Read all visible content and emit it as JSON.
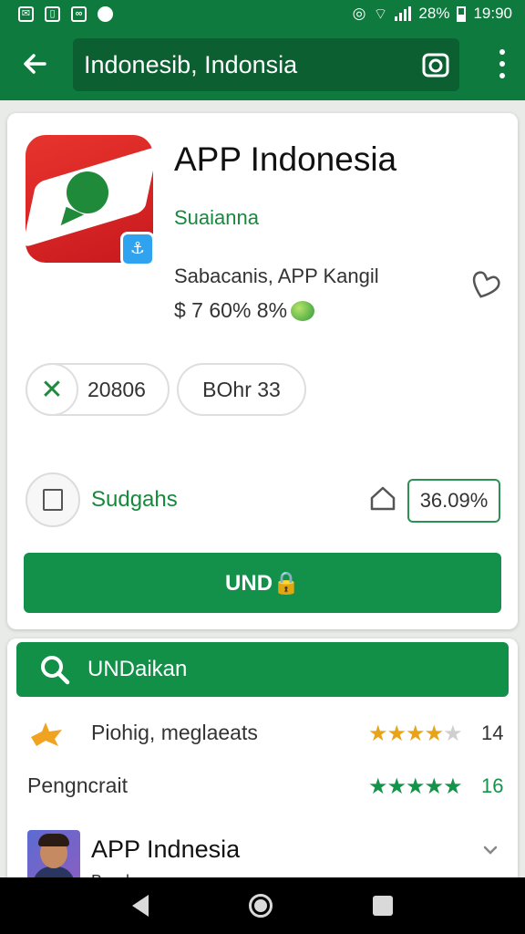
{
  "status_bar": {
    "battery": "28%",
    "time": "19:90"
  },
  "app_bar": {
    "search_query": "Indonesib, Indonsia"
  },
  "app": {
    "title": "APP Indonesia",
    "developer": "Suaianna",
    "subtitle": "Sabacanis, APP Kangil",
    "price": "$ 7 60% 8%"
  },
  "chips": [
    {
      "label": "20806"
    },
    {
      "label": "BOhr 33"
    }
  ],
  "save_row": {
    "label": "Sudgahs",
    "percent": "36.09%"
  },
  "install_button": {
    "label": "UND🔒"
  },
  "search_section": {
    "label": "UNDaikan"
  },
  "ratings": [
    {
      "label": "Piohig, meglaeats",
      "stars": 4,
      "value": "14"
    },
    {
      "label": "Pengncrait",
      "stars": 5,
      "value": "16"
    }
  ],
  "profile": {
    "name": "APP Indnesia",
    "subtitle": "Bandung"
  },
  "colors": {
    "primary_green": "#0e7a3e",
    "button_green": "#13904a",
    "star_gold": "#e7a41a",
    "icon_red": "#d9262a"
  }
}
